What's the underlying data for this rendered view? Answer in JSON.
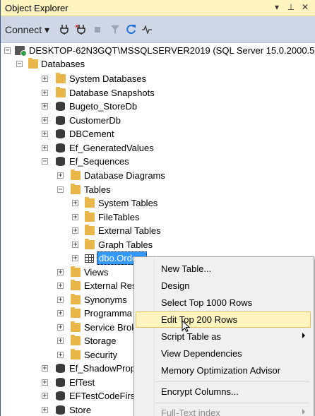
{
  "panel": {
    "title": "Object Explorer",
    "controls": [
      "▾",
      "⊥",
      "✕"
    ]
  },
  "toolbar": {
    "connect_label": "Connect ▾"
  },
  "tree": {
    "server": "DESKTOP-62N3GQT\\MSSQLSERVER2019 (SQL Server 15.0.2000.5 - D",
    "databases": "Databases",
    "system_databases": "System Databases",
    "database_snapshots": "Database Snapshots",
    "db1": "Bugeto_StoreDb",
    "db2": "CustomerDb",
    "db3": "DBCement",
    "db4": "Ef_GeneratedValues",
    "db5": "Ef_Sequences",
    "database_diagrams": "Database Diagrams",
    "tables": "Tables",
    "system_tables": "System Tables",
    "file_tables": "FileTables",
    "external_tables": "External Tables",
    "graph_tables": "Graph Tables",
    "selected_table": "dbo.Orders",
    "views": "Views",
    "external_res": "External Res",
    "synonyms": "Synonyms",
    "programma": "Programma",
    "service_brok": "Service Brok",
    "storage": "Storage",
    "security": "Security",
    "db6": "Ef_ShadowProp",
    "db7": "EfTest",
    "db8": "EFTestCodeFirst",
    "db9": "Store"
  },
  "context_menu": {
    "new_table": "New Table...",
    "design": "Design",
    "select_top": "Select Top 1000 Rows",
    "edit_top": "Edit Top 200 Rows",
    "script_table": "Script Table as",
    "view_dependencies": "View Dependencies",
    "memory_opt": "Memory Optimization Advisor",
    "encrypt_columns": "Encrypt Columns...",
    "fulltext_index": "Full-Text index"
  }
}
